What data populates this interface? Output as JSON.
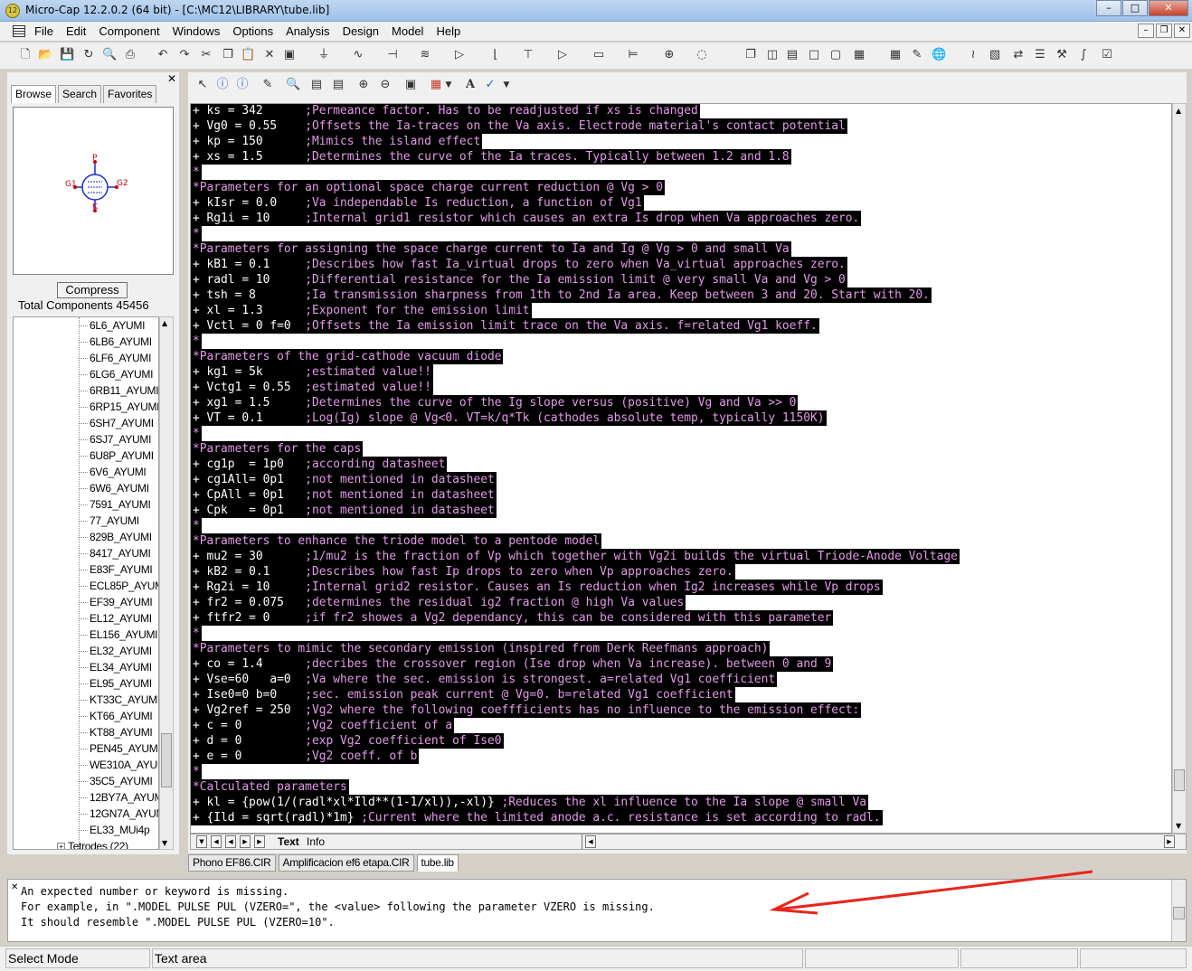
{
  "window": {
    "title": "Micro-Cap 12.2.0.2 (64 bit) - [C:\\MC12\\LIBRARY\\tube.lib]"
  },
  "menu": [
    "File",
    "Edit",
    "Component",
    "Windows",
    "Options",
    "Analysis",
    "Design",
    "Model",
    "Help"
  ],
  "browser": {
    "tabs": [
      "Browse",
      "Search",
      "Favorites"
    ],
    "symbol_pins": [
      "P",
      "G1",
      "G2",
      "K"
    ],
    "compress_label": "Compress",
    "total_components": "Total Components 45456",
    "tree_items": [
      "6L6_AYUMI",
      "6LB6_AYUMI",
      "6LF6_AYUMI",
      "6LG6_AYUMI",
      "6RB11_AYUMI",
      "6RP15_AYUMI",
      "6SH7_AYUMI",
      "6SJ7_AYUMI",
      "6U8P_AYUMI",
      "6V6_AYUMI",
      "6W6_AYUMI",
      "7591_AYUMI",
      "77_AYUMI",
      "829B_AYUMI",
      "8417_AYUMI",
      "E83F_AYUMI",
      "ECL85P_AYUM",
      "EF39_AYUMI",
      "EL12_AYUMI",
      "EL156_AYUMI",
      "EL32_AYUMI",
      "EL34_AYUMI",
      "EL95_AYUMI",
      "KT33C_AYUMI",
      "KT66_AYUMI",
      "KT88_AYUMI",
      "PEN45_AYUMI",
      "WE310A_AYUM",
      "35C5_AYUMI",
      "12BY7A_AYUM",
      "12GN7A_AYUM",
      "EL33_MUi4p"
    ],
    "tree_folder": "Tetrodes (22)"
  },
  "code_lines": [
    [
      "+ ks = 342      ",
      ";Permeance factor. Has to be readjusted if xs is changed"
    ],
    [
      "+ Vg0 = 0.55    ",
      ";Offsets the Ia-traces on the Va axis. Electrode material's contact potential"
    ],
    [
      "+ kp = 150      ",
      ";Mimics the island effect"
    ],
    [
      "+ xs = 1.5      ",
      ";Determines the curve of the Ia traces. Typically between 1.2 and 1.8"
    ],
    [
      "*",
      ""
    ],
    [
      "",
      "*Parameters for an optional space charge current reduction @ Vg > 0"
    ],
    [
      "+ kIsr = 0.0    ",
      ";Va independable Is reduction, a function of Vg1"
    ],
    [
      "+ Rg1i = 10     ",
      ";Internal grid1 resistor which causes an extra Is drop when Va approaches zero."
    ],
    [
      "*",
      ""
    ],
    [
      "",
      "*Parameters for assigning the space charge current to Ia and Ig @ Vg > 0 and small Va"
    ],
    [
      "+ kB1 = 0.1     ",
      ";Describes how fast Ia_virtual drops to zero when Va_virtual approaches zero."
    ],
    [
      "+ radl = 10     ",
      ";Differential resistance for the Ia emission limit @ very small Va and Vg > 0"
    ],
    [
      "+ tsh = 8       ",
      ";Ia transmission sharpness from 1th to 2nd Ia area. Keep between 3 and 20. Start with 20."
    ],
    [
      "+ xl = 1.3      ",
      ";Exponent for the emission limit"
    ],
    [
      "+ Vctl = 0 f=0  ",
      ";Offsets the Ia emission limit trace on the Va axis. f=related Vg1 koeff."
    ],
    [
      "*",
      ""
    ],
    [
      "",
      "*Parameters of the grid-cathode vacuum diode"
    ],
    [
      "+ kg1 = 5k      ",
      ";estimated value!!"
    ],
    [
      "+ Vctg1 = 0.55  ",
      ";estimated value!!"
    ],
    [
      "+ xg1 = 1.5     ",
      ";Determines the curve of the Ig slope versus (positive) Vg and Va >> 0"
    ],
    [
      "+ VT = 0.1      ",
      ";Log(Ig) slope @ Vg<0. VT=k/q*Tk (cathodes absolute temp, typically 1150K)"
    ],
    [
      "*",
      ""
    ],
    [
      "",
      "*Parameters for the caps"
    ],
    [
      "+ cg1p  = 1p0   ",
      ";according datasheet"
    ],
    [
      "+ cg1All= 0p1   ",
      ";not mentioned in datasheet"
    ],
    [
      "+ CpAll = 0p1   ",
      ";not mentioned in datasheet"
    ],
    [
      "+ Cpk   = 0p1   ",
      ";not mentioned in datasheet"
    ],
    [
      "*",
      ""
    ],
    [
      "",
      "*Parameters to enhance the triode model to a pentode model"
    ],
    [
      "+ mu2 = 30      ",
      ";1/mu2 is the fraction of Vp which together with Vg2i builds the virtual Triode-Anode Voltage"
    ],
    [
      "+ kB2 = 0.1     ",
      ";Describes how fast Ip drops to zero when Vp approaches zero."
    ],
    [
      "+ Rg2i = 10     ",
      ";Internal grid2 resistor. Causes an Is reduction when Ig2 increases while Vp drops"
    ],
    [
      "+ fr2 = 0.075   ",
      ";determines the residual ig2 fraction @ high Va values"
    ],
    [
      "+ ftfr2 = 0     ",
      ";if fr2 showes a Vg2 dependancy, this can be considered with this parameter"
    ],
    [
      "*",
      ""
    ],
    [
      "",
      "*Parameters to mimic the secondary emission (inspired from Derk Reefmans approach)"
    ],
    [
      "+ co = 1.4      ",
      ";decribes the crossover region (Ise drop when Va increase). between 0 and 9"
    ],
    [
      "+ Vse=60   a=0  ",
      ";Va where the sec. emission is strongest. a=related Vg1 coefficient"
    ],
    [
      "+ Ise0=0 b=0    ",
      ";sec. emission peak current @ Vg=0. b=related Vg1 coefficient"
    ],
    [
      "+ Vg2ref = 250  ",
      ";Vg2 where the following coeffficients has no influence to the emission effect:"
    ],
    [
      "+ c = 0         ",
      ";Vg2 coefficient of a"
    ],
    [
      "+ d = 0         ",
      ";exp Vg2 coefficient of Ise0"
    ],
    [
      "+ e = 0         ",
      ";Vg2 coeff. of b"
    ],
    [
      "*",
      ""
    ],
    [
      "",
      "*Calculated parameters"
    ],
    [
      "+ kl = {pow(1/(radl*xl*Ild**(1-1/xl)),-xl)} ",
      ";Reduces the xl influence to the Ia slope @ small Va"
    ],
    [
      "+ {Ild = sqrt(radl)*1m} ",
      ";Current where the limited anode a.c. resistance is set according to radl."
    ]
  ],
  "page_tabs": [
    "Text",
    "Info"
  ],
  "doc_tabs": [
    "Phono EF86.CIR",
    "Amplificacion ef6 etapa.CIR",
    "tube.lib"
  ],
  "active_doc": "tube.lib",
  "messages": [
    "An expected number or keyword is missing.",
    "For example, in \".MODEL PULSE PUL (VZERO=\", the <value> following the parameter VZERO is missing.",
    "It should resemble \".MODEL PULSE PUL (VZERO=10\"."
  ],
  "status": {
    "mode": "Select Mode",
    "area": "Text area"
  },
  "colors": {
    "comment": "#e49ae8",
    "code_bg": "#000000",
    "arrow": "#e8251c"
  }
}
